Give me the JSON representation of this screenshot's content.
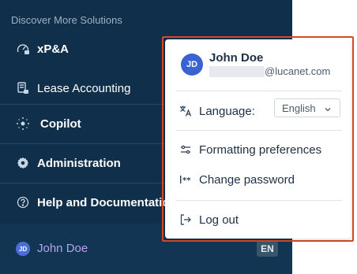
{
  "sidebar": {
    "section_title": "Discover More Solutions",
    "items": [
      {
        "label": "xP&A",
        "icon": "gauge-lock-icon"
      },
      {
        "label": "Lease Accounting",
        "icon": "document-lock-icon"
      },
      {
        "label": "Copilot",
        "icon": "sparkle-icon"
      },
      {
        "label": "Administration",
        "icon": "gear-icon"
      },
      {
        "label": "Help and Documentation",
        "icon": "help-circle-icon"
      }
    ],
    "user": {
      "initials": "JD",
      "name": "John Doe",
      "lang_badge": "EN"
    }
  },
  "popup": {
    "initials": "JD",
    "name": "John Doe",
    "email_domain": "@lucanet.com",
    "language_label": "Language:",
    "language_value": "English",
    "formatting_label": "Formatting preferences",
    "password_label": "Change password",
    "logout_label": "Log out"
  },
  "colors": {
    "sidebar_bg": "#0f2f4a",
    "highlight_border": "#d64a2a",
    "avatar_blue": "#3a62d1",
    "username_purple": "#b9a2f0"
  }
}
